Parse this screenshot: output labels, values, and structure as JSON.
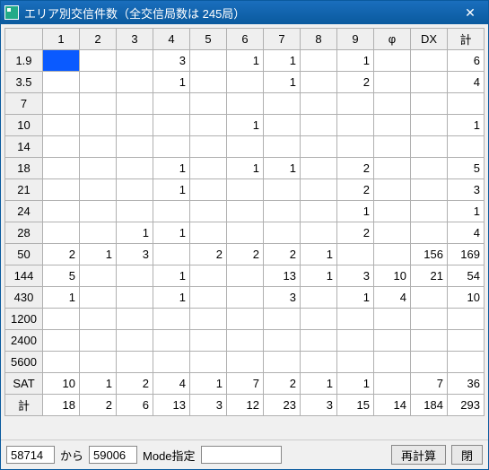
{
  "window": {
    "title": "エリア別交信件数（全交信局数は 245局）"
  },
  "columns": [
    "1",
    "2",
    "3",
    "4",
    "5",
    "6",
    "7",
    "8",
    "9",
    "φ",
    "DX",
    "計"
  ],
  "rows": [
    {
      "h": "1.9",
      "c": [
        "",
        "",
        "",
        "3",
        "",
        "1",
        "1",
        "",
        "1",
        "",
        "",
        "6"
      ]
    },
    {
      "h": "3.5",
      "c": [
        "",
        "",
        "",
        "1",
        "",
        "",
        "1",
        "",
        "2",
        "",
        "",
        "4"
      ]
    },
    {
      "h": "7",
      "c": [
        "",
        "",
        "",
        "",
        "",
        "",
        "",
        "",
        "",
        "",
        "",
        ""
      ]
    },
    {
      "h": "10",
      "c": [
        "",
        "",
        "",
        "",
        "",
        "1",
        "",
        "",
        "",
        "",
        "",
        "1"
      ]
    },
    {
      "h": "14",
      "c": [
        "",
        "",
        "",
        "",
        "",
        "",
        "",
        "",
        "",
        "",
        "",
        ""
      ]
    },
    {
      "h": "18",
      "c": [
        "",
        "",
        "",
        "1",
        "",
        "1",
        "1",
        "",
        "2",
        "",
        "",
        "5"
      ]
    },
    {
      "h": "21",
      "c": [
        "",
        "",
        "",
        "1",
        "",
        "",
        "",
        "",
        "2",
        "",
        "",
        "3"
      ]
    },
    {
      "h": "24",
      "c": [
        "",
        "",
        "",
        "",
        "",
        "",
        "",
        "",
        "1",
        "",
        "",
        "1"
      ]
    },
    {
      "h": "28",
      "c": [
        "",
        "",
        "1",
        "1",
        "",
        "",
        "",
        "",
        "2",
        "",
        "",
        "4"
      ]
    },
    {
      "h": "50",
      "c": [
        "2",
        "1",
        "3",
        "",
        "2",
        "2",
        "2",
        "1",
        "",
        "",
        "156",
        "169"
      ]
    },
    {
      "h": "144",
      "c": [
        "5",
        "",
        "",
        "1",
        "",
        "",
        "13",
        "1",
        "3",
        "10",
        "21",
        "54"
      ]
    },
    {
      "h": "430",
      "c": [
        "1",
        "",
        "",
        "1",
        "",
        "",
        "3",
        "",
        "1",
        "4",
        "",
        "10"
      ]
    },
    {
      "h": "1200",
      "c": [
        "",
        "",
        "",
        "",
        "",
        "",
        "",
        "",
        "",
        "",
        "",
        ""
      ]
    },
    {
      "h": "2400",
      "c": [
        "",
        "",
        "",
        "",
        "",
        "",
        "",
        "",
        "",
        "",
        "",
        ""
      ]
    },
    {
      "h": "5600",
      "c": [
        "",
        "",
        "",
        "",
        "",
        "",
        "",
        "",
        "",
        "",
        "",
        ""
      ]
    },
    {
      "h": "SAT",
      "c": [
        "10",
        "1",
        "2",
        "4",
        "1",
        "7",
        "2",
        "1",
        "1",
        "",
        "7",
        "36"
      ]
    },
    {
      "h": "計",
      "c": [
        "18",
        "2",
        "6",
        "13",
        "3",
        "12",
        "23",
        "3",
        "15",
        "14",
        "184",
        "293"
      ]
    }
  ],
  "bottom": {
    "from": "58714",
    "from_to_label": "から",
    "to": "59006",
    "mode_label": "Mode指定",
    "mode_value": "",
    "recalc": "再計算",
    "close": "閉"
  },
  "selected_cell": {
    "row": 0,
    "col": 0
  }
}
